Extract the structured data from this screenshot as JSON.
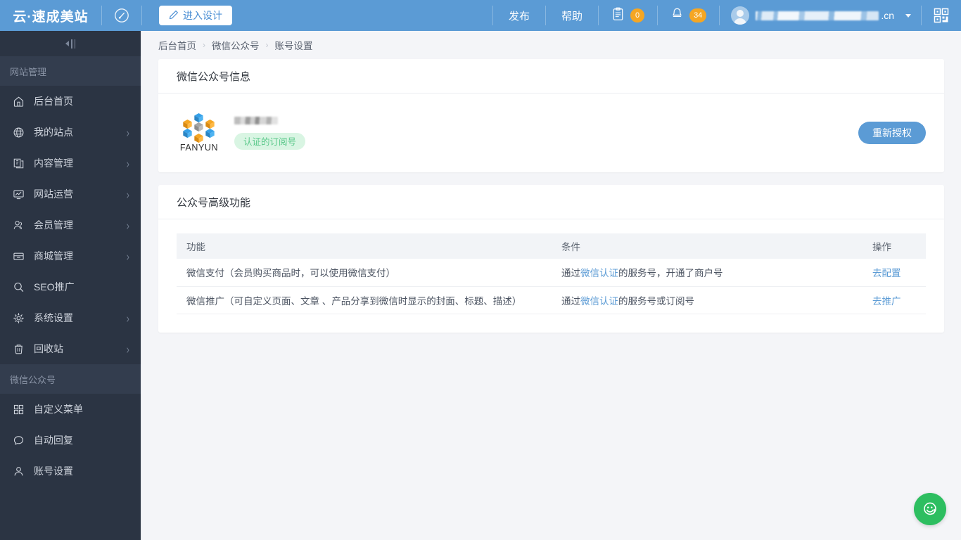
{
  "header": {
    "brand": "云·速成美站",
    "gauge_icon": "gauge-icon",
    "design_button": "进入设计",
    "pencil_icon": "pencil-icon",
    "publish": "发布",
    "help": "帮助",
    "clipboard_icon": "clipboard-icon",
    "clipboard_badge": "0",
    "bell_icon": "bell-icon",
    "bell_badge": "34",
    "username_suffix": ".cn",
    "qr_icon": "qr-code-icon",
    "bg_color": "#5b9bd5",
    "badge_color": "#f5a623"
  },
  "sidebar": {
    "bg_color": "#2b3443",
    "collapse_label": "collapse-sidebar",
    "sections": [
      {
        "title": "网站管理",
        "items": [
          {
            "label": "后台首页",
            "icon": "home-icon",
            "arrow": false
          },
          {
            "label": "我的站点",
            "icon": "globe-icon",
            "arrow": true
          },
          {
            "label": "内容管理",
            "icon": "documents-icon",
            "arrow": true
          },
          {
            "label": "网站运营",
            "icon": "monitor-chart-icon",
            "arrow": true
          },
          {
            "label": "会员管理",
            "icon": "users-icon",
            "arrow": true
          },
          {
            "label": "商城管理",
            "icon": "archive-icon",
            "arrow": true
          },
          {
            "label": "SEO推广",
            "icon": "search-icon",
            "arrow": false
          },
          {
            "label": "系统设置",
            "icon": "gear-icon",
            "arrow": true
          },
          {
            "label": "回收站",
            "icon": "trash-icon",
            "arrow": true
          }
        ]
      },
      {
        "title": "微信公众号",
        "items": [
          {
            "label": "自定义菜单",
            "icon": "grid-icon",
            "arrow": false
          },
          {
            "label": "自动回复",
            "icon": "chat-bubble-icon",
            "arrow": false
          },
          {
            "label": "账号设置",
            "icon": "user-icon",
            "arrow": false
          }
        ]
      }
    ]
  },
  "breadcrumb": {
    "items": [
      "后台首页",
      "微信公众号",
      "账号设置"
    ],
    "separator": "›"
  },
  "wechat_card": {
    "title": "微信公众号信息",
    "logo_text": "FANYUN",
    "logo_alt": "fanyun-logo",
    "account_name": "",
    "verified_tag": "认证的订阅号",
    "reauth_button": "重新授权",
    "tag_bg": "#d9f5e3",
    "tag_color": "#5ac88a"
  },
  "features_card": {
    "title": "公众号高级功能",
    "columns": [
      "功能",
      "条件",
      "操作"
    ],
    "rows": [
      {
        "feature": "微信支付（会员购买商品时，可以使用微信支付）",
        "cond_prefix": "通过",
        "cond_link": "微信认证",
        "cond_suffix": "的服务号，开通了商户号",
        "action": "去配置"
      },
      {
        "feature": "微信推广（可自定义页面、文章 、产品分享到微信时显示的封面、标题、描述）",
        "cond_prefix": "通过",
        "cond_link": "微信认证",
        "cond_suffix": "的服务号或订阅号",
        "action": "去推广"
      }
    ],
    "link_color": "#5b9bd5"
  },
  "fab": {
    "icon": "customer-service-icon",
    "color": "#2dbe60"
  }
}
